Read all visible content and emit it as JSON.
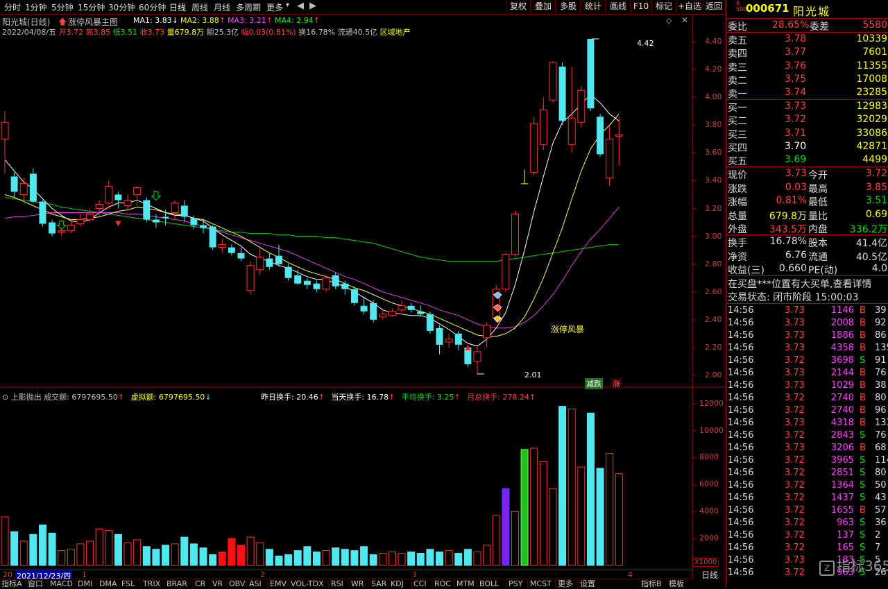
{
  "toolbar": {
    "periods": [
      "分时",
      "1分钟",
      "5分钟",
      "15分钟",
      "30分钟",
      "60分钟",
      "日线",
      "周线",
      "月线",
      "多周期",
      "更多"
    ],
    "buttons": [
      "复权",
      "叠加",
      "多股",
      "统计",
      "画线",
      "F10",
      "标记",
      "+自选",
      "返回"
    ]
  },
  "header": {
    "title": "阳光城(日线)",
    "indicator": "涨停风暴主图",
    "ma": [
      {
        "label": "MA1: 3.83",
        "arrow": "↓",
        "color": "#ffffff"
      },
      {
        "label": "MA2: 3.88",
        "arrow": "↑",
        "color": "#ffff00"
      },
      {
        "label": "MA3: 3.21",
        "arrow": "↑",
        "color": "#ff40ff"
      },
      {
        "label": "MA4: 2.94",
        "arrow": "↑",
        "color": "#00ff00"
      }
    ],
    "date": "2022/04/08/五",
    "open": "开3.72",
    "high": "高3.85",
    "low": "低3.51",
    "close": "收3.73",
    "volume": "量679.8万",
    "amount": "额25.3亿",
    "change": "幅0.03(0.81%)",
    "turnover": "换16.78%",
    "float": "流通40.5亿",
    "sector": "区域地产"
  },
  "price_axis": [
    "4.40",
    "4.20",
    "4.00",
    "3.80",
    "3.60",
    "3.40",
    "3.20",
    "3.00",
    "2.80",
    "2.60",
    "2.40",
    "2.20",
    "2.00"
  ],
  "annotations": {
    "high_mark": "4.42",
    "low_mark": "2.01",
    "signal": "涨停风暴",
    "tag_down": "减跌",
    "tag_up": "涨"
  },
  "sub": {
    "title": "上影抛出",
    "volume": "成交额: 6797695.50",
    "virtual": "虚拟额: 6797695.50",
    "prev_turn": "昨日换手: 20.46",
    "today_turn": "当天换手: 16.78",
    "avg_turn": "平均换手: 3.25",
    "month_turn": "月总换手: 278.24",
    "axis": [
      "12000",
      "10000",
      "8000",
      "6000",
      "4000",
      "2000"
    ],
    "unit": "X1000"
  },
  "date_bar": {
    "start": "2021/12/23/四",
    "months": [
      "1",
      "2",
      "3",
      "4"
    ]
  },
  "tabs": [
    "指标A",
    "窗口",
    "MACD",
    "DMI",
    "DMA",
    "FSL",
    "TRIX",
    "BRAR",
    "CR",
    "VR",
    "OBV",
    "ASI",
    "EMV",
    "VOL-TDX",
    "RSI",
    "WR",
    "SAR",
    "KDJ",
    "CCI",
    "ROC",
    "MTM",
    "BOLL",
    "PSY",
    "MCST",
    "更多",
    "设置"
  ],
  "tab_right": [
    "指标B",
    "模板"
  ],
  "period_label": "日线",
  "stock": {
    "code": "000671",
    "name": "阳光城",
    "badge": "R",
    "badge_sub": "500"
  },
  "committee": {
    "ratio_label": "委比",
    "ratio": "28.65%",
    "diff_label": "委差",
    "diff": "5580"
  },
  "asks": [
    {
      "label": "卖五",
      "price": "3.78",
      "vol": "10339"
    },
    {
      "label": "卖四",
      "price": "3.77",
      "vol": "7601"
    },
    {
      "label": "卖三",
      "price": "3.76",
      "vol": "11355"
    },
    {
      "label": "卖二",
      "price": "3.75",
      "vol": "17008"
    },
    {
      "label": "卖一",
      "price": "3.74",
      "vol": "23285"
    }
  ],
  "bids": [
    {
      "label": "买一",
      "price": "3.73",
      "vol": "12983"
    },
    {
      "label": "买二",
      "price": "3.72",
      "vol": "32029"
    },
    {
      "label": "买三",
      "price": "3.71",
      "vol": "33086"
    },
    {
      "label": "买四",
      "price": "3.70",
      "vol": "42871"
    },
    {
      "label": "买五",
      "price": "3.69",
      "vol": "4499"
    }
  ],
  "stats": [
    [
      "现价",
      "3.73",
      "今开",
      "3.72"
    ],
    [
      "涨跌",
      "0.03",
      "最高",
      "3.85"
    ],
    [
      "涨幅",
      "0.81%",
      "最低",
      "3.51"
    ],
    [
      "总量",
      "679.8万",
      "量比",
      "0.69"
    ],
    [
      "外盘",
      "343.5万",
      "内盘",
      "336.2万"
    ]
  ],
  "stats2": [
    [
      "换手",
      "16.78%",
      "股本",
      "41.4亿"
    ],
    [
      "净资",
      "6.76",
      "流通",
      "40.5亿"
    ],
    [
      "收益(三)",
      "0.660",
      "PE(动)",
      "4.0"
    ]
  ],
  "notice": "在买盘***位置有大买单,查看详情",
  "status": "交易状态: 闭市阶段 15:00:03",
  "ticks": [
    [
      "14:56",
      "3.73",
      "1146",
      "B",
      "39"
    ],
    [
      "14:56",
      "3.73",
      "2008",
      "B",
      "92"
    ],
    [
      "14:56",
      "3.73",
      "1886",
      "B",
      "86"
    ],
    [
      "14:56",
      "3.73",
      "4358",
      "B",
      "135"
    ],
    [
      "14:56",
      "3.72",
      "3698",
      "S",
      "91"
    ],
    [
      "14:56",
      "3.73",
      "2144",
      "B",
      "76"
    ],
    [
      "14:56",
      "3.73",
      "1029",
      "B",
      "38"
    ],
    [
      "14:56",
      "3.72",
      "2740",
      "B",
      "80"
    ],
    [
      "14:56",
      "3.72",
      "2740",
      "B",
      "96"
    ],
    [
      "14:56",
      "3.73",
      "4318",
      "B",
      "133"
    ],
    [
      "14:56",
      "3.72",
      "2843",
      "S",
      "76"
    ],
    [
      "14:56",
      "3.73",
      "3206",
      "B",
      "68"
    ],
    [
      "14:56",
      "3.72",
      "3965",
      "S",
      "114"
    ],
    [
      "14:56",
      "3.72",
      "2851",
      "S",
      "80"
    ],
    [
      "14:56",
      "3.72",
      "1364",
      "S",
      "50"
    ],
    [
      "14:56",
      "3.72",
      "1437",
      "S",
      "43"
    ],
    [
      "14:56",
      "3.72",
      "1655",
      "B",
      "57"
    ],
    [
      "14:56",
      "3.72",
      "963",
      "S",
      "36"
    ],
    [
      "14:56",
      "3.72",
      "137",
      "S",
      "2"
    ],
    [
      "14:56",
      "3.72",
      "165",
      "S",
      "7"
    ],
    [
      "14:56",
      "3.73",
      "183",
      "S",
      "5"
    ],
    [
      "14:56",
      "3.72",
      "963",
      "S",
      "26"
    ]
  ],
  "watermark": "指标365",
  "chart_data": {
    "type": "candlestick",
    "ylim": [
      2.0,
      4.45
    ],
    "candles": [
      [
        3.7,
        3.82,
        3.9,
        3.45
      ],
      [
        3.43,
        3.32,
        3.46,
        3.28
      ],
      [
        3.3,
        3.38,
        3.42,
        3.26
      ],
      [
        3.45,
        3.25,
        3.49,
        3.24
      ],
      [
        3.25,
        3.09,
        3.26,
        3.07
      ],
      [
        3.1,
        3.02,
        3.12,
        3.0
      ],
      [
        3.03,
        3.04,
        3.06,
        3.0
      ],
      [
        3.04,
        3.08,
        3.12,
        3.02
      ],
      [
        3.09,
        3.12,
        3.16,
        3.07
      ],
      [
        3.12,
        3.16,
        3.2,
        3.1
      ],
      [
        3.2,
        3.23,
        3.26,
        3.15
      ],
      [
        3.24,
        3.36,
        3.4,
        3.2
      ],
      [
        3.3,
        3.26,
        3.32,
        3.2
      ],
      [
        3.22,
        3.26,
        3.3,
        3.19
      ],
      [
        3.3,
        3.35,
        3.36,
        3.22
      ],
      [
        3.26,
        3.12,
        3.28,
        3.1
      ],
      [
        3.12,
        3.1,
        3.16,
        3.06
      ],
      [
        3.14,
        3.13,
        3.19,
        3.08
      ],
      [
        3.17,
        3.24,
        3.26,
        3.12
      ],
      [
        3.22,
        3.14,
        3.26,
        3.1
      ],
      [
        3.13,
        3.08,
        3.15,
        3.05
      ],
      [
        3.08,
        3.06,
        3.12,
        3.02
      ],
      [
        3.07,
        2.92,
        3.08,
        2.9
      ],
      [
        2.92,
        2.94,
        2.98,
        2.88
      ],
      [
        2.92,
        2.88,
        2.94,
        2.86
      ],
      [
        2.88,
        2.84,
        2.92,
        2.82
      ],
      [
        2.61,
        2.79,
        2.82,
        2.58
      ],
      [
        2.76,
        2.85,
        2.92,
        2.72
      ],
      [
        2.84,
        2.78,
        2.88,
        2.76
      ],
      [
        2.86,
        2.8,
        2.94,
        2.78
      ],
      [
        2.78,
        2.7,
        2.8,
        2.68
      ],
      [
        2.72,
        2.66,
        2.76,
        2.65
      ],
      [
        2.68,
        2.65,
        2.7,
        2.62
      ],
      [
        2.66,
        2.62,
        2.68,
        2.6
      ],
      [
        2.62,
        2.7,
        2.72,
        2.6
      ],
      [
        2.72,
        2.64,
        2.74,
        2.62
      ],
      [
        2.66,
        2.62,
        2.68,
        2.58
      ],
      [
        2.62,
        2.52,
        2.64,
        2.5
      ],
      [
        2.5,
        2.46,
        2.56,
        2.44
      ],
      [
        2.52,
        2.4,
        2.54,
        2.38
      ],
      [
        2.42,
        2.44,
        2.48,
        2.4
      ],
      [
        2.43,
        2.46,
        2.48,
        2.42
      ],
      [
        2.47,
        2.5,
        2.54,
        2.45
      ],
      [
        2.5,
        2.47,
        2.52,
        2.45
      ],
      [
        2.46,
        2.44,
        2.5,
        2.42
      ],
      [
        2.44,
        2.32,
        2.46,
        2.3
      ],
      [
        2.34,
        2.22,
        2.36,
        2.15
      ],
      [
        2.24,
        2.26,
        2.3,
        2.2
      ],
      [
        2.3,
        2.22,
        2.32,
        2.18
      ],
      [
        2.2,
        2.08,
        2.22,
        2.06
      ],
      [
        2.1,
        2.17,
        2.21,
        2.01
      ],
      [
        2.27,
        2.36,
        2.38,
        2.2
      ],
      [
        2.41,
        2.62,
        2.65,
        2.38
      ],
      [
        2.62,
        2.87,
        2.88,
        2.6
      ],
      [
        2.87,
        3.16,
        3.18,
        2.85
      ],
      [
        3.38,
        3.38,
        3.48,
        3.38
      ],
      [
        3.46,
        3.81,
        3.86,
        3.44
      ],
      [
        3.66,
        3.91,
        4.0,
        3.62
      ],
      [
        3.98,
        4.25,
        4.26,
        3.96
      ],
      [
        4.22,
        3.83,
        4.25,
        3.8
      ],
      [
        3.66,
        3.85,
        4.22,
        3.6
      ],
      [
        3.82,
        4.05,
        4.08,
        3.78
      ],
      [
        4.42,
        3.92,
        4.42,
        3.9
      ],
      [
        3.86,
        3.59,
        3.88,
        3.57
      ],
      [
        3.42,
        3.7,
        3.8,
        3.36
      ],
      [
        3.72,
        3.73,
        3.85,
        3.51
      ]
    ],
    "ma1": [
      3.55,
      3.47,
      3.39,
      3.34,
      3.27,
      3.2,
      3.15,
      3.11,
      3.1,
      3.12,
      3.17,
      3.21,
      3.24,
      3.24,
      3.26,
      3.23,
      3.2,
      3.17,
      3.15,
      3.15,
      3.13,
      3.11,
      3.06,
      3.01,
      2.97,
      2.93,
      2.87,
      2.84,
      2.82,
      2.79,
      2.77,
      2.74,
      2.71,
      2.69,
      2.69,
      2.66,
      2.64,
      2.6,
      2.56,
      2.52,
      2.47,
      2.45,
      2.44,
      2.43,
      2.43,
      2.41,
      2.37,
      2.33,
      2.28,
      2.23,
      2.21,
      2.26,
      2.34,
      2.45,
      2.65,
      2.9,
      3.18,
      3.43,
      3.67,
      3.82,
      3.88,
      3.95,
      4.02,
      3.96,
      3.88,
      3.83
    ],
    "ma2": [
      3.3,
      3.28,
      3.25,
      3.22,
      3.19,
      3.16,
      3.14,
      3.12,
      3.12,
      3.13,
      3.14,
      3.16,
      3.18,
      3.19,
      3.21,
      3.2,
      3.19,
      3.17,
      3.16,
      3.15,
      3.13,
      3.12,
      3.09,
      3.06,
      3.03,
      3.0,
      2.96,
      2.92,
      2.88,
      2.85,
      2.81,
      2.78,
      2.75,
      2.73,
      2.71,
      2.69,
      2.66,
      2.63,
      2.61,
      2.58,
      2.55,
      2.52,
      2.5,
      2.48,
      2.46,
      2.44,
      2.41,
      2.38,
      2.35,
      2.32,
      2.29,
      2.28,
      2.28,
      2.3,
      2.34,
      2.42,
      2.55,
      2.7,
      2.88,
      3.06,
      3.27,
      3.47,
      3.63,
      3.73,
      3.8,
      3.88
    ],
    "ma3": [
      3.13,
      3.14,
      3.14,
      3.15,
      3.16,
      3.17,
      3.17,
      3.17,
      3.17,
      3.17,
      3.17,
      3.17,
      3.17,
      3.16,
      3.16,
      3.15,
      3.14,
      3.13,
      3.12,
      3.11,
      3.09,
      3.07,
      3.05,
      3.03,
      3.01,
      2.99,
      2.97,
      2.95,
      2.93,
      2.91,
      2.89,
      2.86,
      2.83,
      2.8,
      2.77,
      2.74,
      2.71,
      2.69,
      2.66,
      2.63,
      2.6,
      2.58,
      2.56,
      2.54,
      2.52,
      2.5,
      2.47,
      2.45,
      2.43,
      2.4,
      2.37,
      2.35,
      2.34,
      2.34,
      2.35,
      2.38,
      2.43,
      2.5,
      2.58,
      2.68,
      2.79,
      2.89,
      2.98,
      3.05,
      3.13,
      3.21
    ],
    "ma4": [
      3.28,
      3.27,
      3.26,
      3.25,
      3.24,
      3.23,
      3.21,
      3.2,
      3.19,
      3.18,
      3.17,
      3.16,
      3.15,
      3.14,
      3.13,
      3.12,
      3.11,
      3.1,
      3.09,
      3.08,
      3.07,
      3.06,
      3.05,
      3.04,
      3.03,
      3.03,
      3.02,
      3.02,
      3.02,
      3.01,
      3.01,
      3.0,
      3.0,
      3.0,
      2.99,
      2.99,
      2.98,
      2.97,
      2.96,
      2.95,
      2.93,
      2.91,
      2.89,
      2.87,
      2.85,
      2.84,
      2.83,
      2.82,
      2.82,
      2.82,
      2.82,
      2.82,
      2.82,
      2.83,
      2.84,
      2.85,
      2.86,
      2.87,
      2.88,
      2.89,
      2.9,
      2.91,
      2.92,
      2.93,
      2.94,
      2.94
    ],
    "sub_ylim": [
      0,
      12500
    ],
    "sub_values": [
      3600,
      2500,
      1800,
      2300,
      3000,
      2400,
      1100,
      1200,
      1600,
      1800,
      2700,
      2600,
      2300,
      1700,
      1900,
      1400,
      1200,
      1500,
      1600,
      2100,
      1600,
      1300,
      800,
      1000,
      2000,
      1500,
      2100,
      1700,
      1200,
      700,
      800,
      1100,
      1400,
      1000,
      1100,
      1300,
      1200,
      1100,
      1400,
      800,
      900,
      1000,
      900,
      1000,
      900,
      1200,
      1000,
      1100,
      900,
      1200,
      1000,
      1500,
      3700,
      5700,
      4000,
      8600,
      8700,
      7700,
      5700,
      11800,
      11600,
      7300,
      11300,
      7200,
      8300,
      6800
    ]
  }
}
